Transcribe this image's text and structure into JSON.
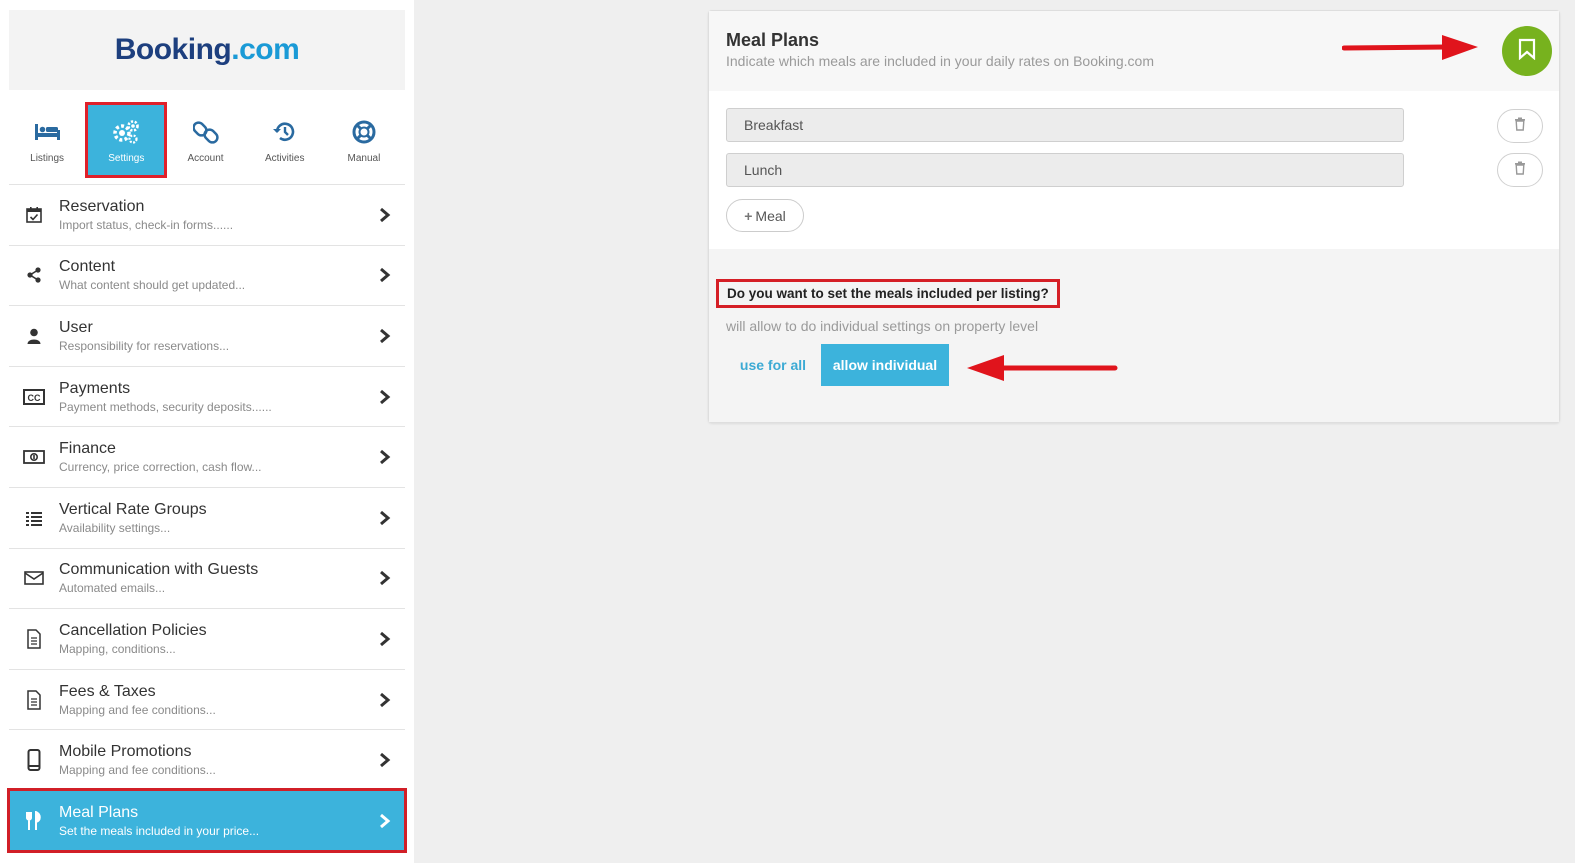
{
  "brand": {
    "part1": "Booking",
    "part2": ".com"
  },
  "topnav": [
    {
      "label": "Listings",
      "icon": "bed-icon"
    },
    {
      "label": "Settings",
      "icon": "gears-icon"
    },
    {
      "label": "Account",
      "icon": "link-icon"
    },
    {
      "label": "Activities",
      "icon": "history-icon"
    },
    {
      "label": "Manual",
      "icon": "lifebuoy-icon"
    }
  ],
  "menu": [
    {
      "title": "Reservation",
      "sub": "Import status, check-in forms......",
      "icon": "calendar-check-icon"
    },
    {
      "title": "Content",
      "sub": "What content should get updated...",
      "icon": "share-icon"
    },
    {
      "title": "User",
      "sub": "Responsibility for reservations...",
      "icon": "user-icon"
    },
    {
      "title": "Payments",
      "sub": "Payment methods, security deposits......",
      "icon": "credit-card-icon"
    },
    {
      "title": "Finance",
      "sub": "Currency, price correction, cash flow...",
      "icon": "money-icon"
    },
    {
      "title": "Vertical Rate Groups",
      "sub": "Availability settings...",
      "icon": "list-icon"
    },
    {
      "title": "Communication with Guests",
      "sub": "Automated emails...",
      "icon": "envelope-icon"
    },
    {
      "title": "Cancellation Policies",
      "sub": "Mapping, conditions...",
      "icon": "document-icon"
    },
    {
      "title": "Fees & Taxes",
      "sub": "Mapping and fee conditions...",
      "icon": "document-icon"
    },
    {
      "title": "Mobile Promotions",
      "sub": "Mapping and fee conditions...",
      "icon": "mobile-icon"
    },
    {
      "title": "Meal Plans",
      "sub": "Set the meals included in your price...",
      "icon": "cutlery-icon"
    }
  ],
  "panel": {
    "title": "Meal Plans",
    "subtitle": "Indicate which meals are included in your daily rates on Booking.com",
    "meals": [
      "Breakfast",
      "Lunch"
    ],
    "add_meal_label": "Meal",
    "question": "Do you want to set the meals included per listing?",
    "question_sub": "will allow to do individual settings on property level",
    "use_for_all_label": "use for all",
    "allow_individual_label": "allow individual"
  },
  "colors": {
    "accent": "#3cb3dc",
    "save": "#77b21e",
    "highlight": "#d51f26",
    "brand_dark": "#1d3f7e",
    "brand_light": "#1a9ad6"
  }
}
